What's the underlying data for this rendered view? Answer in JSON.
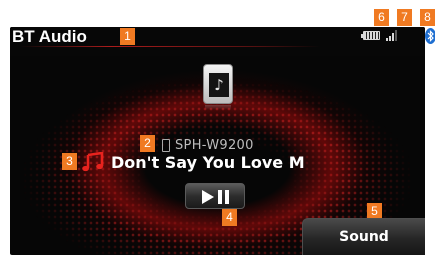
{
  "header": {
    "title": "BT Audio"
  },
  "callouts": {
    "c1": "1",
    "c2": "2",
    "c3": "3",
    "c4": "4",
    "c5": "5",
    "c6": "6",
    "c7": "7",
    "c8": "8"
  },
  "status": {
    "battery_icon": "battery-icon",
    "signal_icon": "signal-strength-icon",
    "bluetooth_icon": "bluetooth-icon"
  },
  "device": {
    "name": "SPH-W9200",
    "icon": "phone-icon"
  },
  "track": {
    "title": "Don't Say You Love M",
    "icon": "music-note-icon"
  },
  "controls": {
    "play_pause_icon": "play-pause-icon",
    "sound_label": "Sound"
  },
  "colors": {
    "callout": "#f07a22",
    "accent_red": "#c8141e",
    "screen_bg": "#060606"
  }
}
